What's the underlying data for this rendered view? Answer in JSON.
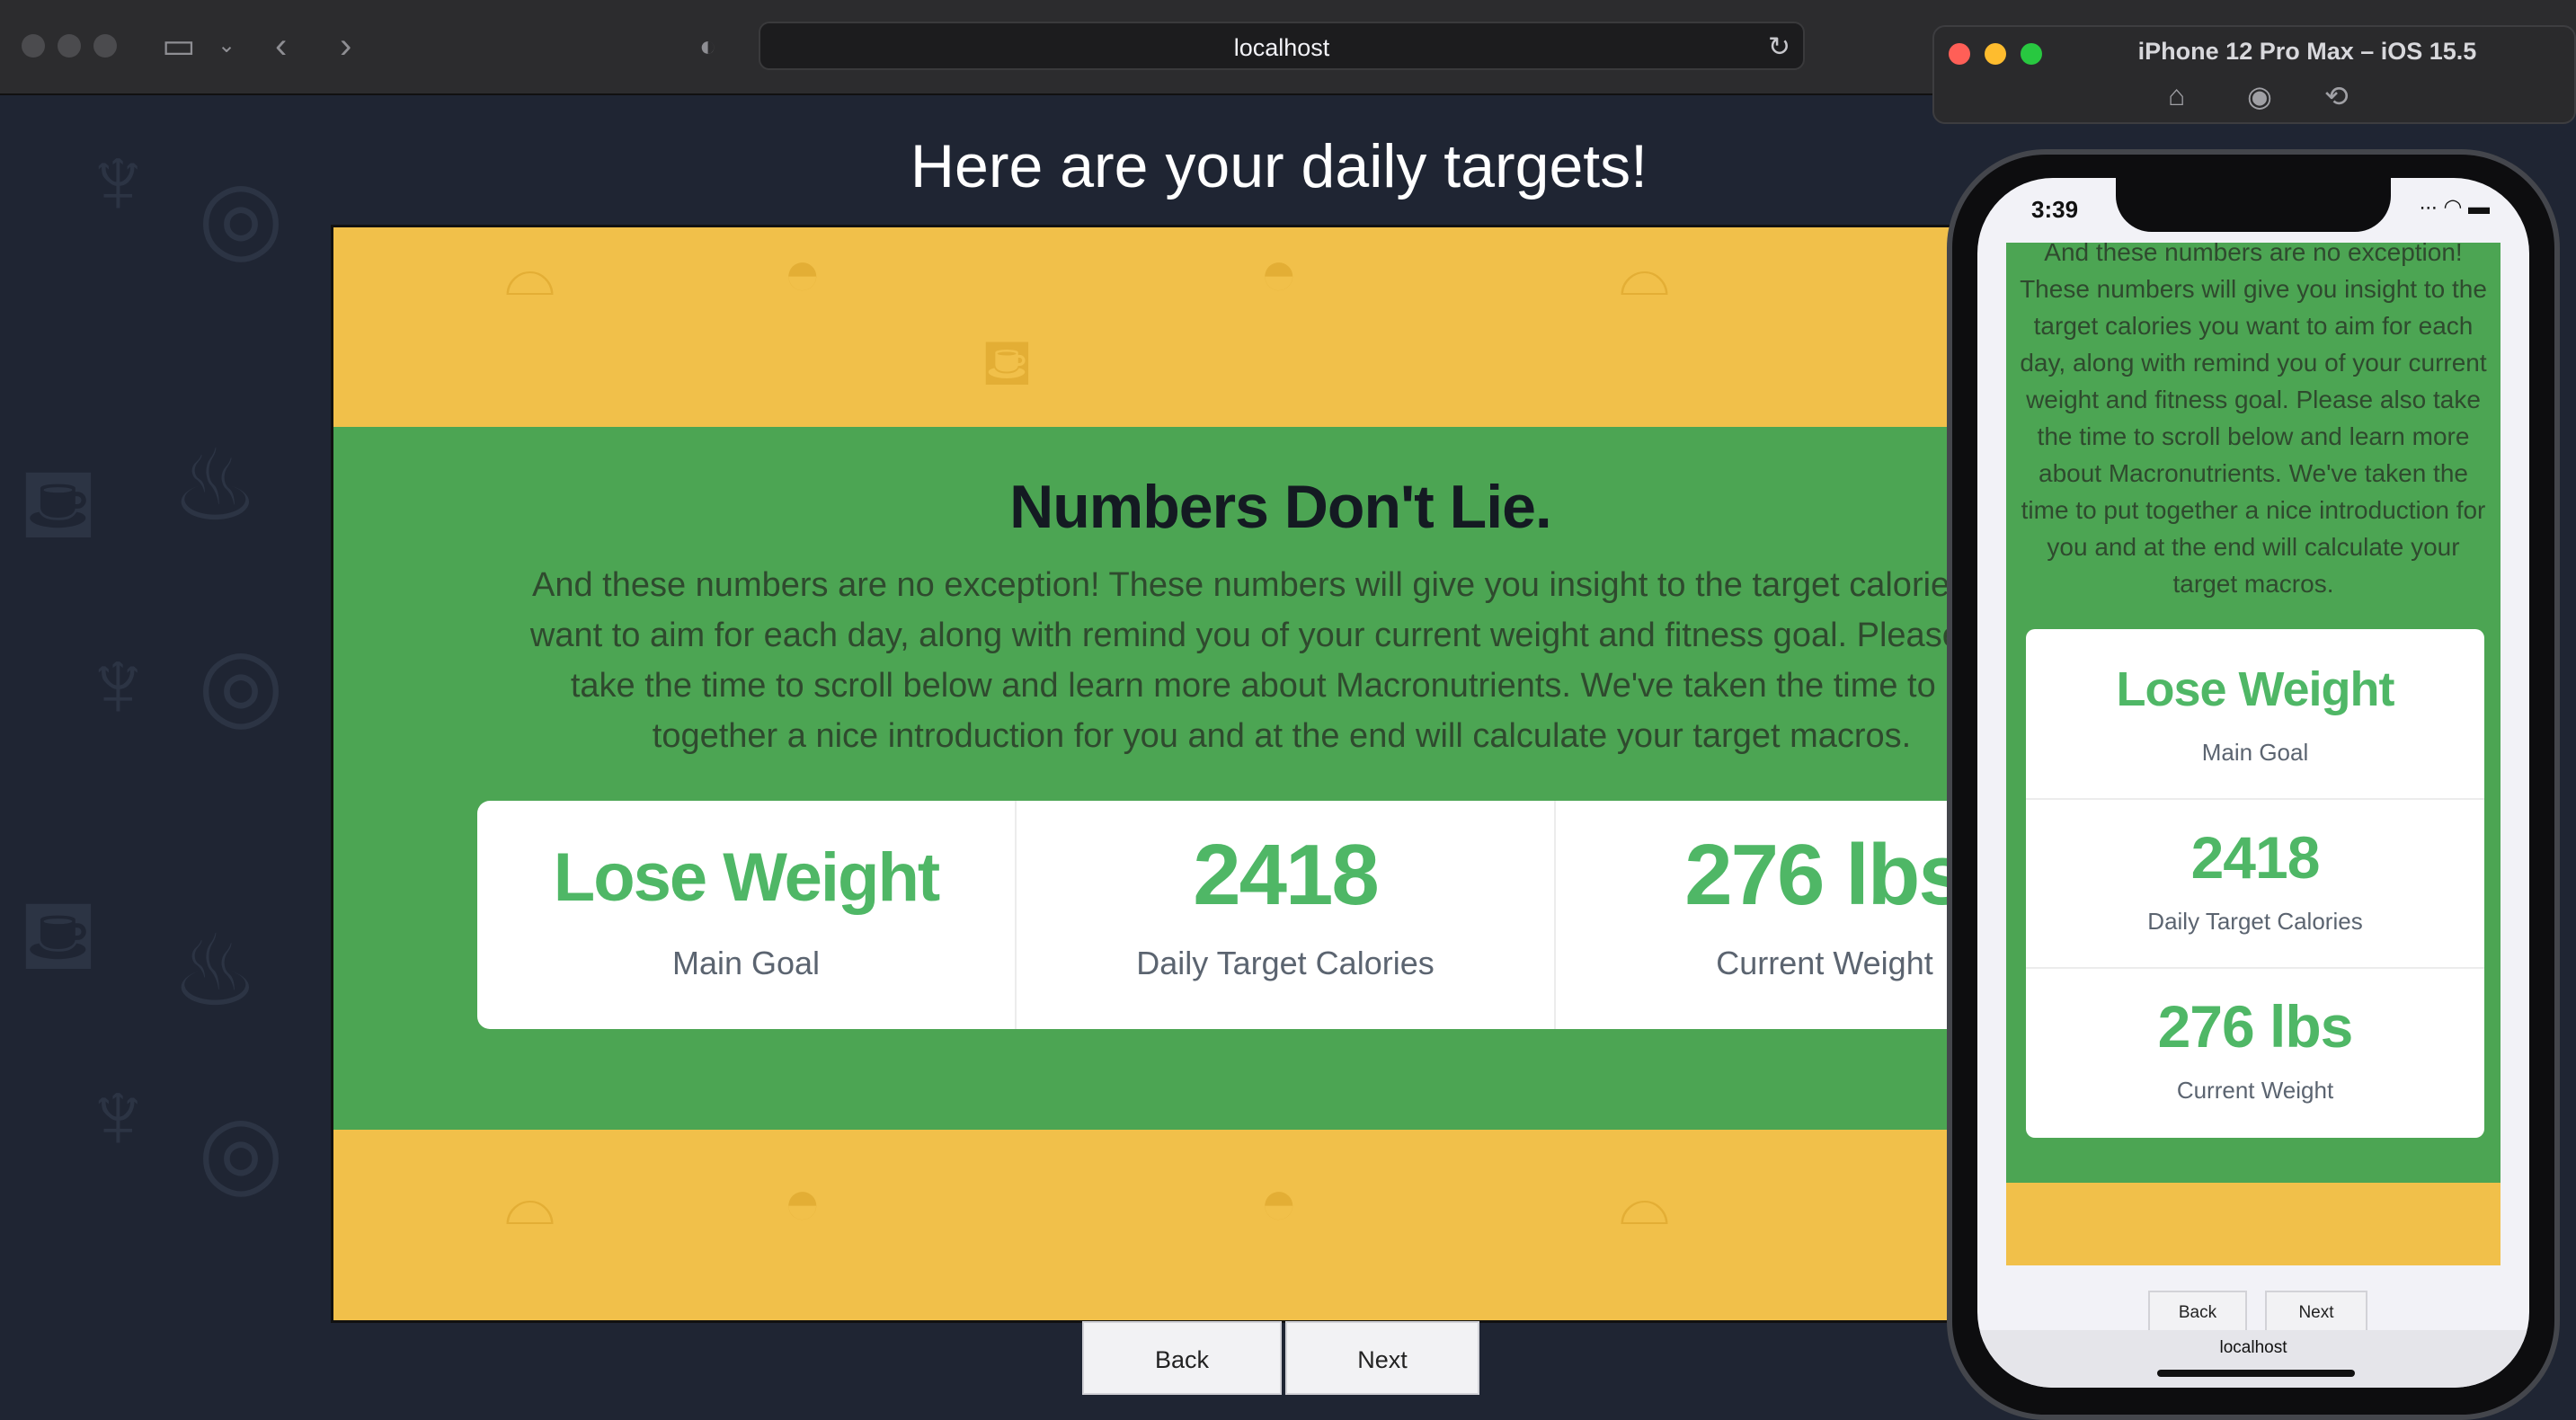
{
  "browser": {
    "url": "localhost",
    "icons": [
      "sidebar-icon",
      "chevron-down-icon",
      "back-arrow-icon",
      "forward-arrow-icon",
      "shield-icon",
      "reload-icon"
    ]
  },
  "page": {
    "title": "Here are your daily targets!",
    "heading": "Numbers Don't Lie.",
    "paragraph": "And these numbers are no exception! These numbers will give you insight to the target calories you want to aim for each day, along with remind you of your current weight and fitness goal. Please also take the time to scroll below and learn more about Macronutrients. We've taken the time to put together a nice introduction for you and at the end will calculate your target macros.",
    "stats": [
      {
        "value": "Lose Weight",
        "label": "Main Goal"
      },
      {
        "value": "2418",
        "label": "Daily Target Calories"
      },
      {
        "value": "276 lbs",
        "label": "Current Weight"
      }
    ],
    "back_label": "Back",
    "next_label": "Next"
  },
  "simulator": {
    "title": "iPhone 12 Pro Max – iOS 15.5",
    "time": "3:39",
    "url": "localhost",
    "paragraph": "And these numbers are no exception! These numbers will give you insight to the target calories you want to aim for each day, along with remind you of your current weight and fitness goal. Please also take the time to scroll below and learn more about Macronutrients. We've taken the time to put together a nice introduction for you and at the end will calculate your target macros.",
    "back_label": "Back",
    "next_label": "Next"
  },
  "colors": {
    "accent_green": "#4fb766",
    "band_green": "#4ca553",
    "band_yellow": "#f1c04a",
    "background": "#1f2533"
  }
}
